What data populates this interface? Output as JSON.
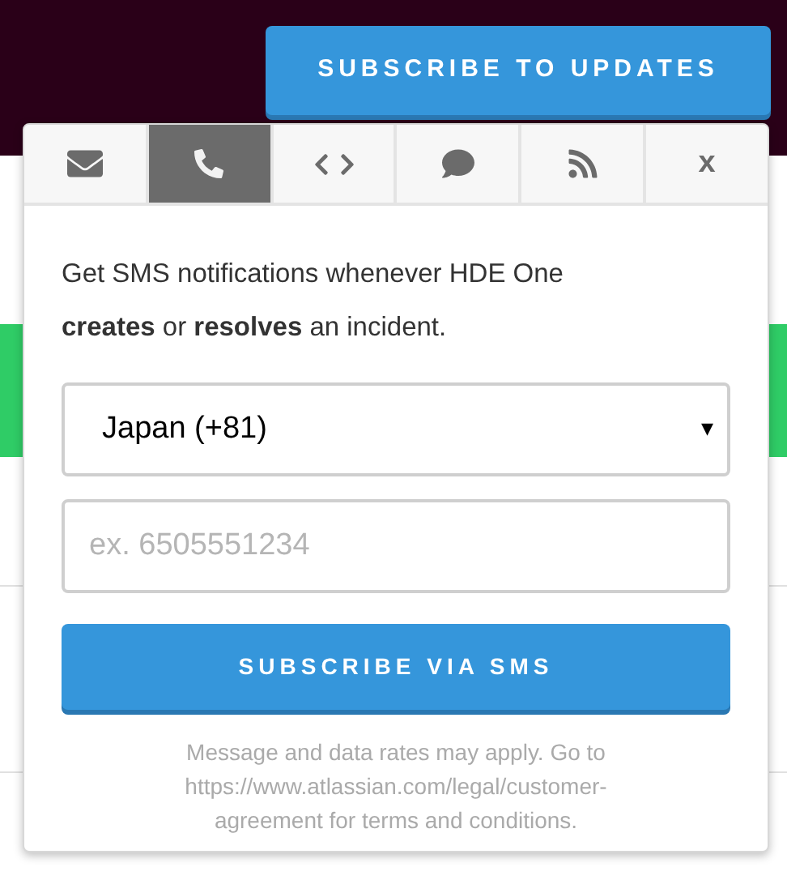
{
  "header": {
    "subscribe_button": "SUBSCRIBE TO UPDATES"
  },
  "popup": {
    "tabs": [
      {
        "kind": "email",
        "selected": false
      },
      {
        "kind": "sms",
        "selected": true
      },
      {
        "kind": "webhook",
        "selected": false
      },
      {
        "kind": "chat",
        "selected": false
      },
      {
        "kind": "rss",
        "selected": false
      },
      {
        "kind": "close",
        "label": "x",
        "selected": false
      }
    ],
    "intro": "Get SMS notifications whenever HDE One **creates** or **resolves** an incident.",
    "country_select": {
      "value": "Japan (+81)",
      "caret": "▾"
    },
    "phone_field": {
      "placeholder": "ex. 6505551234"
    },
    "submit_button": "SUBSCRIBE VIA SMS",
    "disclaimer": "Message and data rates may apply. Go to https://www.atlassian.com/legal/customer-agreement for terms and conditions."
  }
}
